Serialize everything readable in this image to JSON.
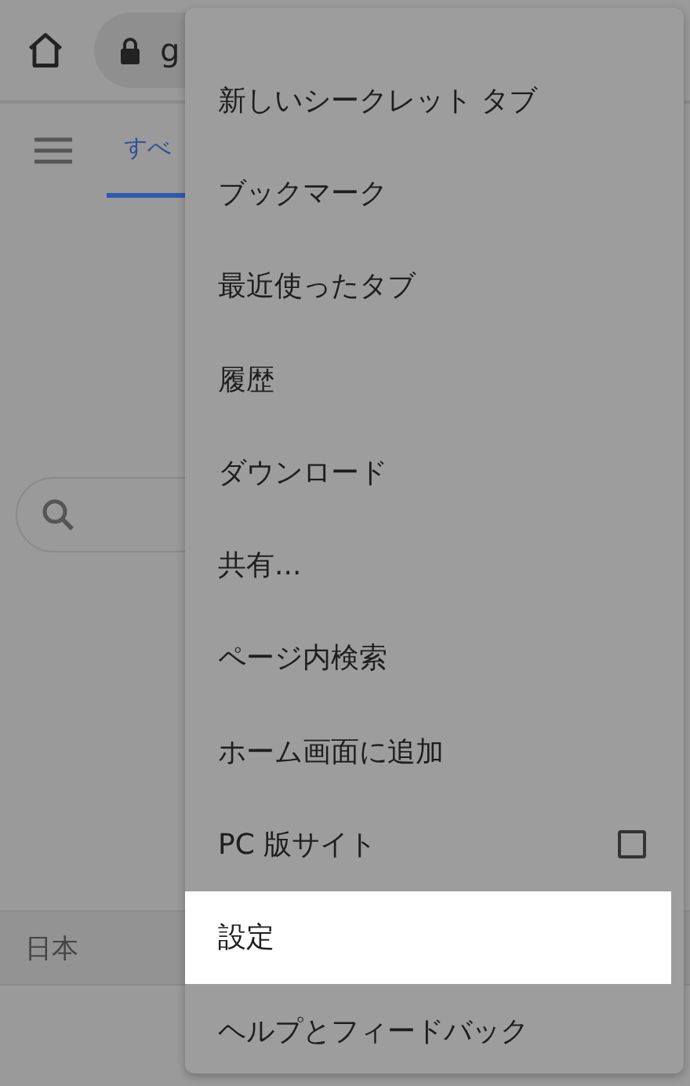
{
  "toolbar": {
    "address": "g"
  },
  "tabs": [
    {
      "label": "すべ",
      "selected": true
    }
  ],
  "footer": {
    "region": "日本"
  },
  "menu": {
    "items": [
      {
        "kind": "item",
        "label": "新しいシークレット タブ",
        "selected": false
      },
      {
        "kind": "item",
        "label": "ブックマーク",
        "selected": false
      },
      {
        "kind": "item",
        "label": "最近使ったタブ",
        "selected": false
      },
      {
        "kind": "item",
        "label": "履歴",
        "selected": false
      },
      {
        "kind": "item",
        "label": "ダウンロード",
        "selected": false
      },
      {
        "kind": "item",
        "label": "共有...",
        "selected": false
      },
      {
        "kind": "item",
        "label": "ページ内検索",
        "selected": false
      },
      {
        "kind": "item",
        "label": "ホーム画面に追加",
        "selected": false
      },
      {
        "kind": "checkbox",
        "label": "PC 版サイト",
        "checked": false,
        "selected": false
      },
      {
        "kind": "item",
        "label": "設定",
        "selected": true
      },
      {
        "kind": "item",
        "label": "ヘルプとフィードバック",
        "selected": false
      }
    ]
  }
}
